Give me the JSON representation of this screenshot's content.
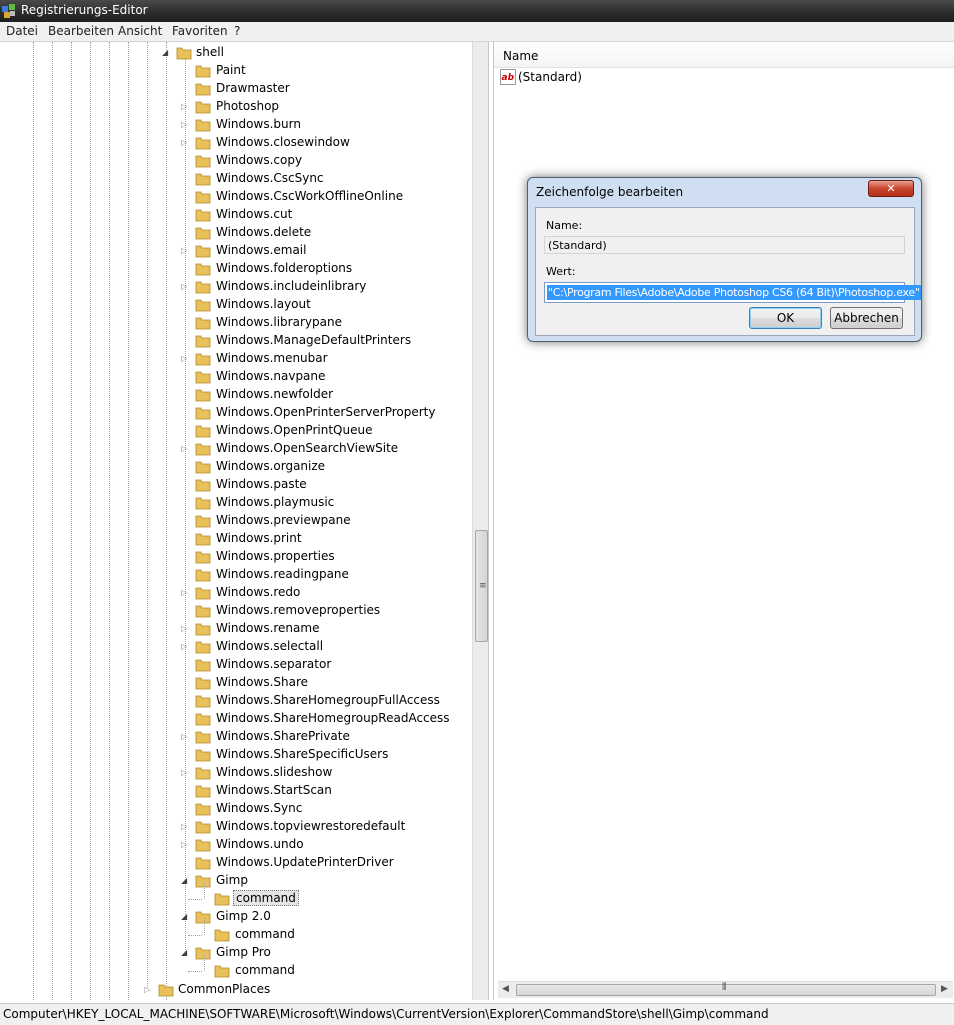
{
  "window": {
    "title": "Registrierungs-Editor"
  },
  "menu": [
    "Datei",
    "Bearbeiten",
    "Ansicht",
    "Favoriten",
    "?"
  ],
  "tree": {
    "root": "shell",
    "items": [
      {
        "label": "Paint",
        "arrow": ""
      },
      {
        "label": "Drawmaster",
        "arrow": ""
      },
      {
        "label": "Photoshop",
        "arrow": "closed"
      },
      {
        "label": "Windows.burn",
        "arrow": "closed"
      },
      {
        "label": "Windows.closewindow",
        "arrow": "closed"
      },
      {
        "label": "Windows.copy",
        "arrow": ""
      },
      {
        "label": "Windows.CscSync",
        "arrow": ""
      },
      {
        "label": "Windows.CscWorkOfflineOnline",
        "arrow": ""
      },
      {
        "label": "Windows.cut",
        "arrow": ""
      },
      {
        "label": "Windows.delete",
        "arrow": ""
      },
      {
        "label": "Windows.email",
        "arrow": "closed"
      },
      {
        "label": "Windows.folderoptions",
        "arrow": ""
      },
      {
        "label": "Windows.includeinlibrary",
        "arrow": "closed"
      },
      {
        "label": "Windows.layout",
        "arrow": ""
      },
      {
        "label": "Windows.librarypane",
        "arrow": ""
      },
      {
        "label": "Windows.ManageDefaultPrinters",
        "arrow": ""
      },
      {
        "label": "Windows.menubar",
        "arrow": "closed"
      },
      {
        "label": "Windows.navpane",
        "arrow": ""
      },
      {
        "label": "Windows.newfolder",
        "arrow": ""
      },
      {
        "label": "Windows.OpenPrinterServerProperty",
        "arrow": ""
      },
      {
        "label": "Windows.OpenPrintQueue",
        "arrow": ""
      },
      {
        "label": "Windows.OpenSearchViewSite",
        "arrow": "closed"
      },
      {
        "label": "Windows.organize",
        "arrow": ""
      },
      {
        "label": "Windows.paste",
        "arrow": ""
      },
      {
        "label": "Windows.playmusic",
        "arrow": ""
      },
      {
        "label": "Windows.previewpane",
        "arrow": ""
      },
      {
        "label": "Windows.print",
        "arrow": ""
      },
      {
        "label": "Windows.properties",
        "arrow": ""
      },
      {
        "label": "Windows.readingpane",
        "arrow": ""
      },
      {
        "label": "Windows.redo",
        "arrow": "closed"
      },
      {
        "label": "Windows.removeproperties",
        "arrow": ""
      },
      {
        "label": "Windows.rename",
        "arrow": "closed"
      },
      {
        "label": "Windows.selectall",
        "arrow": "closed"
      },
      {
        "label": "Windows.separator",
        "arrow": ""
      },
      {
        "label": "Windows.Share",
        "arrow": ""
      },
      {
        "label": "Windows.ShareHomegroupFullAccess",
        "arrow": ""
      },
      {
        "label": "Windows.ShareHomegroupReadAccess",
        "arrow": ""
      },
      {
        "label": "Windows.SharePrivate",
        "arrow": "closed"
      },
      {
        "label": "Windows.ShareSpecificUsers",
        "arrow": ""
      },
      {
        "label": "Windows.slideshow",
        "arrow": "closed"
      },
      {
        "label": "Windows.StartScan",
        "arrow": ""
      },
      {
        "label": "Windows.Sync",
        "arrow": ""
      },
      {
        "label": "Windows.topviewrestoredefault",
        "arrow": "closed"
      },
      {
        "label": "Windows.undo",
        "arrow": "closed"
      },
      {
        "label": "Windows.UpdatePrinterDriver",
        "arrow": ""
      },
      {
        "label": "Gimp",
        "arrow": "open"
      },
      {
        "label": "command",
        "arrow": "",
        "child": true,
        "selected": true
      },
      {
        "label": "Gimp 2.0",
        "arrow": "open"
      },
      {
        "label": "command",
        "arrow": "",
        "child": true
      },
      {
        "label": "Gimp Pro",
        "arrow": "open"
      },
      {
        "label": "command",
        "arrow": "",
        "child": true
      }
    ],
    "after": "CommonPlaces"
  },
  "values": {
    "column_name": "Name",
    "rows": [
      {
        "name": "(Standard)",
        "icon": "ab-string-icon"
      }
    ]
  },
  "status": {
    "path": "Computer\\HKEY_LOCAL_MACHINE\\SOFTWARE\\Microsoft\\Windows\\CurrentVersion\\Explorer\\CommandStore\\shell\\Gimp\\command"
  },
  "dialog": {
    "title": "Zeichenfolge bearbeiten",
    "close_label": "✕",
    "name_label": "Name:",
    "name_value": "(Standard)",
    "value_label": "Wert:",
    "value_text": "\"C:\\Program Files\\Adobe\\Adobe Photoshop CS6 (64 Bit)\\Photoshop.exe\"",
    "ok_label": "OK",
    "cancel_label": "Abbrechen"
  },
  "colors": {
    "selection": "#3399ff",
    "folder": "#e8c15a",
    "dialog_frame": "#cfdff1"
  }
}
